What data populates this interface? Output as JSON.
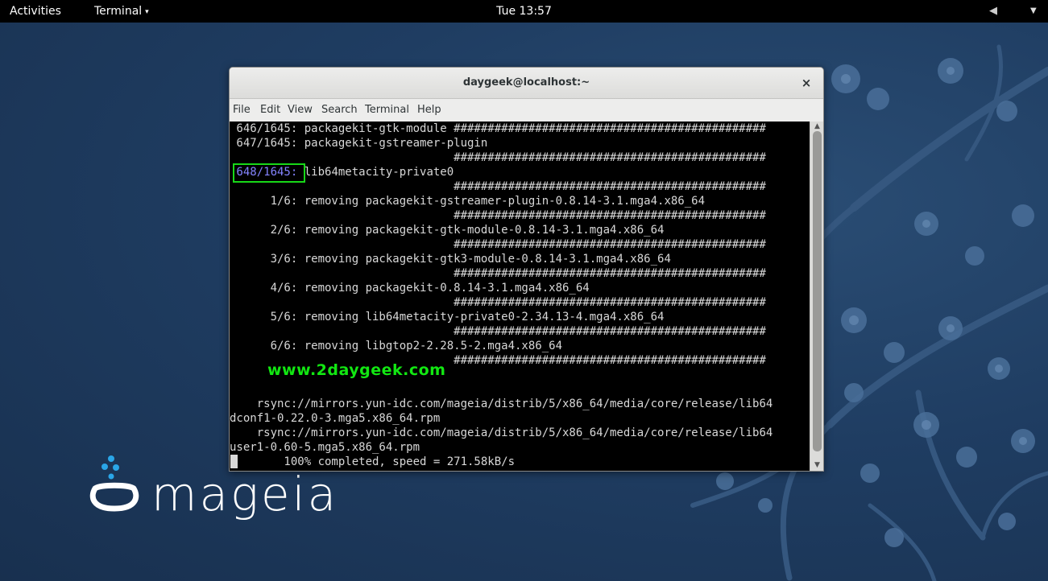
{
  "topbar": {
    "activities": "Activities",
    "app_menu": "Terminal",
    "app_menu_caret": "▾",
    "clock": "Tue 13:57",
    "volume_icon": "◀",
    "power_icon": "▼"
  },
  "window": {
    "title": "daygeek@localhost:~",
    "close": "×"
  },
  "menubar": {
    "items": [
      "File",
      "Edit",
      "View",
      "Search",
      "Terminal",
      "Help"
    ]
  },
  "terminal": {
    "lines": [
      " 646/1645: packagekit-gtk-module ##############################################",
      " 647/1645: packagekit-gstreamer-plugin",
      "                                 ##############################################",
      " 648/1645: lib64metacity-private0",
      "                                 ##############################################",
      "      1/6: removing packagekit-gstreamer-plugin-0.8.14-3.1.mga4.x86_64",
      "                                 ##############################################",
      "      2/6: removing packagekit-gtk-module-0.8.14-3.1.mga4.x86_64",
      "                                 ##############################################",
      "      3/6: removing packagekit-gtk3-module-0.8.14-3.1.mga4.x86_64",
      "                                 ##############################################",
      "      4/6: removing packagekit-0.8.14-3.1.mga4.x86_64",
      "                                 ##############################################",
      "      5/6: removing lib64metacity-private0-2.34.13-4.mga4.x86_64",
      "                                 ##############################################",
      "      6/6: removing libgtop2-2.28.5-2.mga4.x86_64",
      "                                 ##############################################",
      "",
      "",
      "    rsync://mirrors.yun-idc.com/mageia/distrib/5/x86_64/media/core/release/lib64",
      "dconf1-0.22.0-3.mga5.x86_64.rpm",
      "    rsync://mirrors.yun-idc.com/mageia/distrib/5/x86_64/media/core/release/lib64",
      "user1-0.60-5.mga5.x86_64.rpm",
      "        100% completed, speed = 271.58kB/s"
    ],
    "highlight_text": " 648/1645:",
    "watermark": "www.2daygeek.com"
  },
  "desktop": {
    "logo_text": "mageia"
  },
  "colors": {
    "highlight_border": "#18d818",
    "highlight_text": "#8484ff",
    "watermark": "#12e712",
    "terminal_bg": "#000000",
    "terminal_fg": "#d8d8d8",
    "desktop_bg": "#1f3d62"
  }
}
